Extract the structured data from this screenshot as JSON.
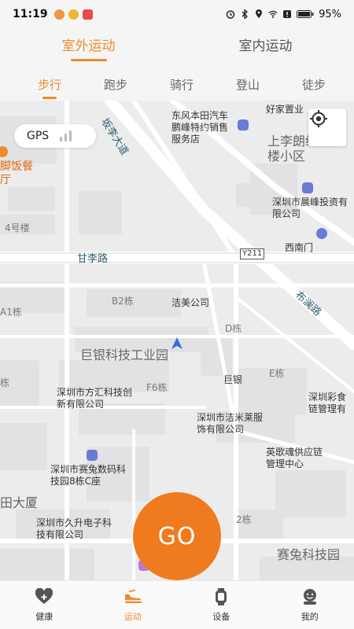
{
  "status_bar": {
    "time": "11:19",
    "battery": "95%"
  },
  "top_tabs": [
    {
      "label": "室外运动",
      "active": true
    },
    {
      "label": "室内运动",
      "active": false
    }
  ],
  "sub_tabs": [
    {
      "label": "步行",
      "active": true
    },
    {
      "label": "跑步",
      "active": false
    },
    {
      "label": "骑行",
      "active": false
    },
    {
      "label": "登山",
      "active": false
    },
    {
      "label": "徒步",
      "active": false
    }
  ],
  "map": {
    "gps_label": "GPS",
    "go_label": "GO",
    "labels": {
      "road_1": "坂李大道",
      "road_2": "甘李路",
      "road_3": "布澜路",
      "road_sign": "Y211",
      "honda": "东风本田汽车鹏峰特约销售服务店",
      "haojia": "好家置业",
      "shangli": "上李朗统建楼小区",
      "chenfeng": "深圳市晨峰投资有限公司",
      "ximen": "西南门",
      "foot_massage": "脚饭餐厅",
      "bldg4": "4号楼",
      "a1": "A1栋",
      "b2": "B2栋",
      "jiemei": "洁美公司",
      "d_bldg": "D栋",
      "juyin_park": "巨银科技工业园",
      "juyin": "巨银",
      "e_bldg": "E栋",
      "f6": "F6栋",
      "dong": "栋",
      "fanghui": "深圳市方汇科技创新有限公司",
      "caijie": "深圳彩食链管理有",
      "jiemilai": "深圳市洁米莱服饰有限公司",
      "yinggehun": "英歌魂供应链管理中心",
      "saitu": "深圳市赛兔数码科技园8栋C座",
      "dasha": "田大厦",
      "jiusheng": "深圳市久升电子科技有限公司",
      "two_bldg": "2栋",
      "saitu_park": "赛兔科技园"
    }
  },
  "bottom_nav": [
    {
      "label": "健康",
      "icon": "heart-plus-icon",
      "active": false
    },
    {
      "label": "运动",
      "icon": "sneaker-icon",
      "active": true
    },
    {
      "label": "设备",
      "icon": "watch-icon",
      "active": false
    },
    {
      "label": "我的",
      "icon": "profile-icon",
      "active": false
    }
  ],
  "colors": {
    "accent": "#f08a2c",
    "go_button": "#f07a1e"
  }
}
